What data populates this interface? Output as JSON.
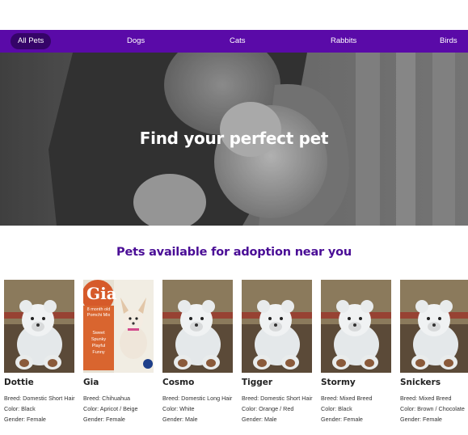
{
  "nav": {
    "items": [
      {
        "label": "All Pets",
        "active": true
      },
      {
        "label": "Dogs",
        "active": false
      },
      {
        "label": "Cats",
        "active": false
      },
      {
        "label": "Rabbits",
        "active": false
      },
      {
        "label": "Birds",
        "active": false
      }
    ]
  },
  "hero": {
    "title": "Find your perfect pet"
  },
  "section": {
    "title": "Pets available for adoption near you"
  },
  "pets": [
    {
      "name": "Dottie",
      "breed": "Breed: Domestic Short Hair",
      "color": "Color: Black",
      "gender": "Gender: Female",
      "image": "placeholder-teddy-bear"
    },
    {
      "name": "Gia",
      "breed": "Breed: Chihuahua",
      "color": "Color: Apricot / Beige",
      "gender": "Gender: Female",
      "image": "chihuahua-flyer",
      "flyer": {
        "title": "Gia",
        "subtitle": "8 month old Pomchi Mix",
        "traits": [
          "Sweet",
          "Spunky",
          "Playful",
          "Funny"
        ]
      }
    },
    {
      "name": "Cosmo",
      "breed": "Breed: Domestic Long Hair",
      "color": "Color: White",
      "gender": "Gender: Male",
      "image": "placeholder-teddy-bear"
    },
    {
      "name": "Tigger",
      "breed": "Breed: Domestic Short Hair",
      "color": "Color: Orange / Red",
      "gender": "Gender: Male",
      "image": "placeholder-teddy-bear"
    },
    {
      "name": "Stormy",
      "breed": "Breed: Mixed Breed",
      "color": "Color: Black",
      "gender": "Gender: Female",
      "image": "placeholder-teddy-bear"
    },
    {
      "name": "Snickers",
      "breed": "Breed: Mixed Breed",
      "color": "Color: Brown / Chocolate",
      "gender": "Gender: Female",
      "image": "placeholder-teddy-bear"
    }
  ],
  "colors": {
    "nav_bg": "#5a0aa8",
    "nav_active": "#350468",
    "section_title": "#4a0d96"
  }
}
